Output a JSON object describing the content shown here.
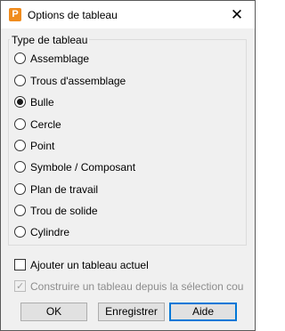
{
  "window": {
    "title": "Options de tableau",
    "app_icon": "P",
    "close_glyph": "✕"
  },
  "group": {
    "legend": "Type de tableau",
    "options": [
      {
        "label": "Assemblage",
        "selected": false
      },
      {
        "label": "Trous d'assemblage",
        "selected": false
      },
      {
        "label": "Bulle",
        "selected": true
      },
      {
        "label": "Cercle",
        "selected": false
      },
      {
        "label": "Point",
        "selected": false
      },
      {
        "label": "Symbole / Composant",
        "selected": false
      },
      {
        "label": "Plan de travail",
        "selected": false
      },
      {
        "label": "Trou de solide",
        "selected": false
      },
      {
        "label": "Cylindre",
        "selected": false
      }
    ]
  },
  "checkboxes": {
    "add_current": {
      "label": "Ajouter un tableau actuel",
      "checked": false,
      "enabled": true
    },
    "build_from_selection": {
      "label": "Construire un tableau depuis la sélection courante",
      "checked": true,
      "enabled": false
    }
  },
  "buttons": {
    "ok": "OK",
    "save": "Enregistrer",
    "help": "Aide"
  }
}
